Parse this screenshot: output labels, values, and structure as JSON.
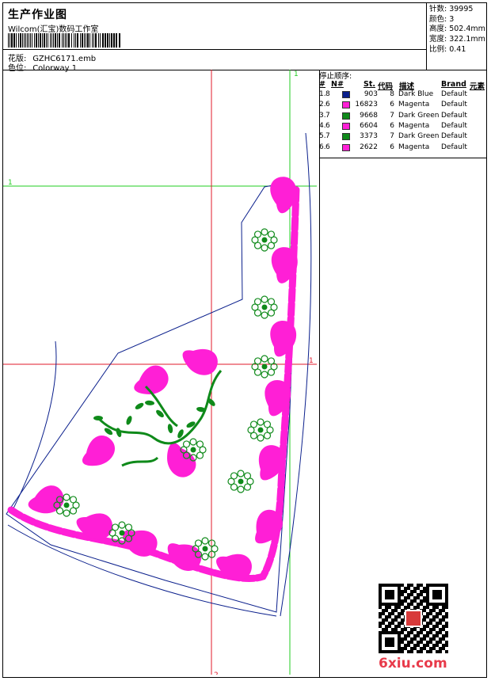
{
  "header": {
    "title": "生产作业图",
    "company": "Wilcom(汇宝)数码工作室",
    "design_label": "花版:",
    "design_file": "GZHC6171.emb",
    "color_label": "色位:",
    "colorway": "Colorway 1"
  },
  "stats": {
    "stitches": "针数: 39995",
    "colors": "颜色: 3",
    "height": "高度: 502.4mm",
    "width": "宽度: 322.1mm",
    "scale": "比例: 0.41"
  },
  "stop_sequence": {
    "title": "停止顺序:",
    "headers": {
      "hash": "#",
      "num": "N#",
      "st": "St.",
      "code": "代码",
      "desc": "描述",
      "brand": "Brand",
      "element": "元素"
    },
    "rows": [
      {
        "idx": "1.",
        "n": "8",
        "color": "#0a1f8c",
        "st": "903",
        "code": "8",
        "desc": "Dark Blue",
        "brand": "Default"
      },
      {
        "idx": "2.",
        "n": "6",
        "color": "#ff1fd6",
        "st": "16823",
        "code": "6",
        "desc": "Magenta",
        "brand": "Default"
      },
      {
        "idx": "3.",
        "n": "7",
        "color": "#0f8a1a",
        "st": "9668",
        "code": "7",
        "desc": "Dark Green",
        "brand": "Default"
      },
      {
        "idx": "4.",
        "n": "6",
        "color": "#ff1fd6",
        "st": "6604",
        "code": "6",
        "desc": "Magenta",
        "brand": "Default"
      },
      {
        "idx": "5.",
        "n": "7",
        "color": "#0f8a1a",
        "st": "3373",
        "code": "7",
        "desc": "Dark Green",
        "brand": "Default"
      },
      {
        "idx": "6.",
        "n": "6",
        "color": "#ff1fd6",
        "st": "2622",
        "code": "6",
        "desc": "Magenta",
        "brand": "Default"
      }
    ]
  },
  "guides": {
    "green_1": "1",
    "green_2": "1",
    "red_1": "1",
    "red_2": "2"
  },
  "watermark": {
    "site": "6xiu.com"
  },
  "colors": {
    "red_guide": "#e0182a",
    "green_guide": "#22cc22",
    "magenta": "#ff1fd6",
    "green": "#0f8a1a",
    "blue": "#0a1f8c"
  }
}
